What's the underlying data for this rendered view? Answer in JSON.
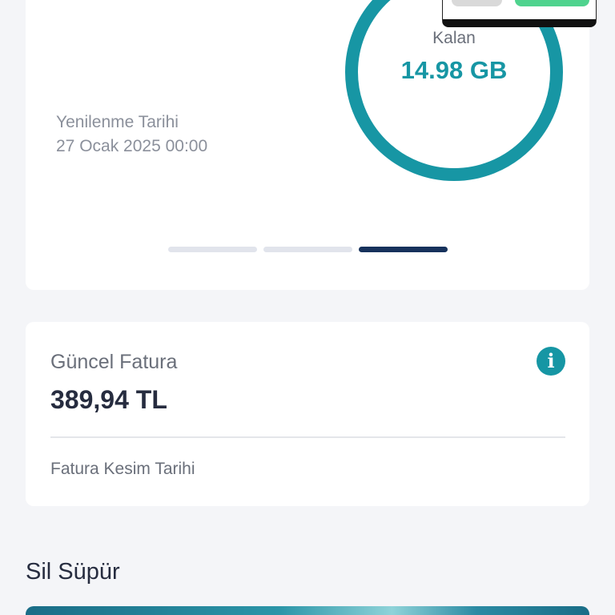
{
  "usage": {
    "renew_label": "Yenilenme Tarihi",
    "renew_date": "27 Ocak 2025 00:00",
    "remaining_label": "Kalan",
    "remaining_value": "14.98 GB",
    "ring_color": "#1796a4",
    "pager": {
      "count": 3,
      "active_index": 2
    }
  },
  "invoice": {
    "title": "Güncel Fatura",
    "amount": "389,94 TL",
    "cut_date_label": "Fatura Kesim Tarihi",
    "info_icon": "info-icon"
  },
  "section": {
    "title": "Sil Süpür"
  },
  "colors": {
    "accent": "#1796a4",
    "pager_active": "#17325c",
    "popup_confirm": "#4fd38e"
  }
}
